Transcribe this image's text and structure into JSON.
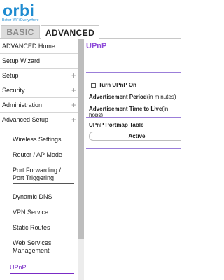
{
  "header": {
    "logo_text": "orbi",
    "tagline": "Better WiFi Everywhere",
    "tabs": [
      {
        "label": "BASIC"
      },
      {
        "label": "ADVANCED"
      }
    ]
  },
  "sidebar": {
    "top_items": [
      {
        "label": "ADVANCED Home",
        "expandable": false
      },
      {
        "label": "Setup Wizard",
        "expandable": false
      },
      {
        "label": "Setup",
        "expandable": true
      },
      {
        "label": "Security",
        "expandable": true
      },
      {
        "label": "Administration",
        "expandable": true
      },
      {
        "label": "Advanced Setup",
        "expandable": true
      }
    ],
    "plus_symbol": "+",
    "sub_items": [
      {
        "label": "Wireless Settings"
      },
      {
        "label": "Router / AP Mode"
      },
      {
        "label": "Port Forwarding / Port Triggering"
      },
      {
        "label": "Dynamic DNS"
      },
      {
        "label": "VPN Service"
      },
      {
        "label": "Static Routes"
      },
      {
        "label": "Web Services Management"
      },
      {
        "label": "UPnP",
        "selected": true
      }
    ]
  },
  "main": {
    "title": "UPnP",
    "turn_on_label": "Turn UPnP On",
    "turn_on_checked": false,
    "adv_period_label": "Advertisement Period",
    "adv_period_unit": "(in minutes)",
    "adv_ttl_label": "Advertisement Time to Live",
    "adv_ttl_unit": "(in hops)",
    "portmap_title": "UPnP Portmap Table",
    "table_header": "Active"
  },
  "colors": {
    "brand_blue": "#1e8bd0",
    "accent_purple": "#8e4ad9"
  }
}
